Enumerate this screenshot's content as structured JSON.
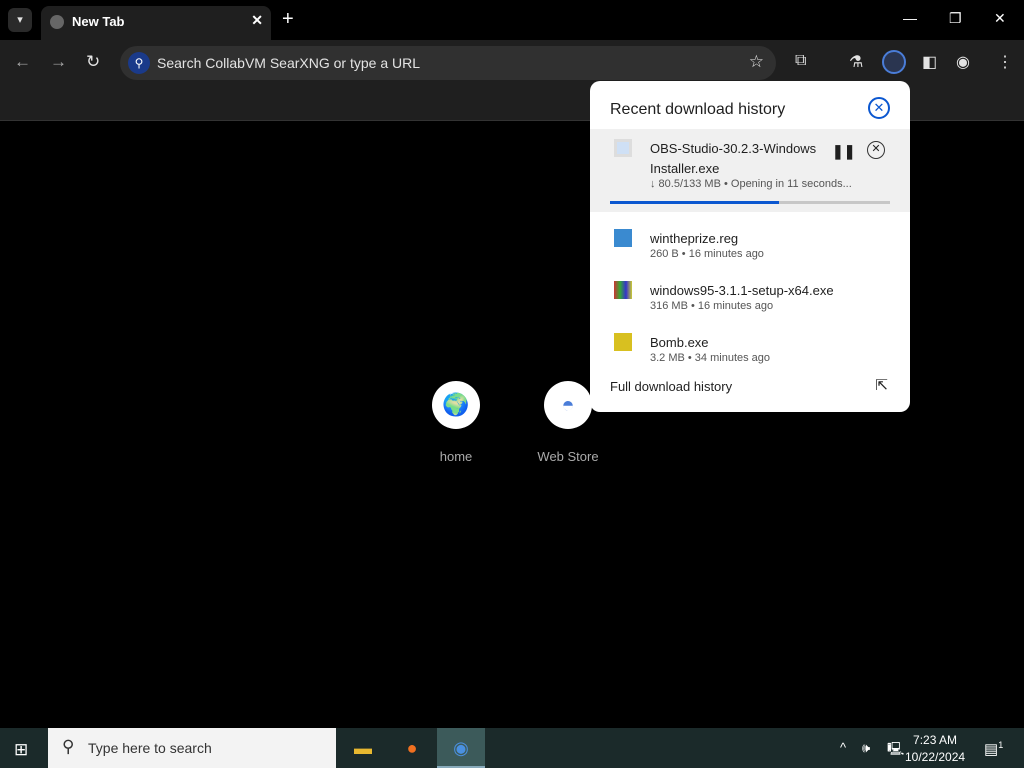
{
  "tab": {
    "title": "New Tab"
  },
  "omnibox": {
    "placeholder": "Search CollabVM SearXNG or type a URL"
  },
  "shortcuts": [
    {
      "label": "home"
    },
    {
      "label": "Web Store"
    }
  ],
  "downloads": {
    "title": "Recent download history",
    "items": [
      {
        "name": "OBS-Studio-30.2.3-Windows Installer.exe",
        "meta": "↓ 80.5/133 MB • Opening in 11 seconds...",
        "progress": 0.605
      },
      {
        "name": "wintheprize.reg",
        "meta": "260 B • 16 minutes ago"
      },
      {
        "name": "windows95-3.1.1-setup-x64.exe",
        "meta": "316 MB • 16 minutes ago"
      },
      {
        "name": "Bomb.exe",
        "meta": "3.2 MB • 34 minutes ago"
      }
    ],
    "full_history": "Full download history"
  },
  "taskbar": {
    "search_placeholder": "Type here to search",
    "time": "7:23 AM",
    "date": "10/22/2024",
    "notifications": "1"
  },
  "colors": {
    "accent": "#0b57d0"
  }
}
